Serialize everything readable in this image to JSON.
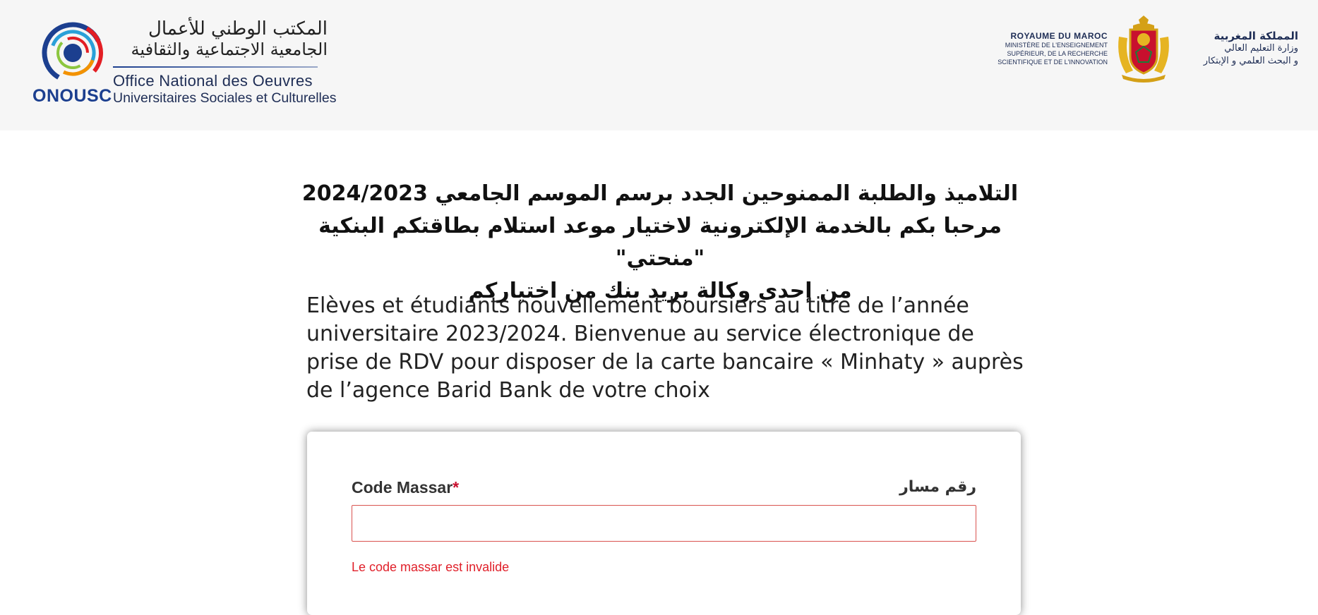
{
  "header": {
    "onousc": {
      "abbr": "ONOUSC",
      "arabic_line1": "المكتب الوطني للأعمال",
      "arabic_line2": "الجامعية الاجتماعية والثقافية",
      "french_line1": "Office National des Oeuvres",
      "french_line2": "Universitaires Sociales et Culturelles"
    },
    "ministry": {
      "fr_kingdom": "ROYAUME DU MAROC",
      "fr_line1": "MINISTÈRE DE L'ENSEIGNEMENT",
      "fr_line2": "SUPÉRIEUR, DE LA RECHERCHE",
      "fr_line3": "SCIENTIFIQUE ET DE L'INNOVATION",
      "ar_kingdom": "المملكة المغربية",
      "ar_line1": "وزارة التعليم العالي",
      "ar_line2": "و البحث العلمي و الإبتكار"
    }
  },
  "main": {
    "arabic_title_line1": "التلاميذ والطلبة الممنوحين الجدد برسم الموسم الجامعي 2024/2023",
    "arabic_title_line2": "مرحبا بكم بالخدمة الإلكترونية لاختيار موعد استلام بطاقتكم البنكية \"منحتي\"",
    "arabic_title_line3": "من إحدى وكالة بريد بنك من اختياركم",
    "french_intro": "Elèves et étudiants nouvellement boursiers au titre de l’année universitaire 2023/2024. Bienvenue au service électronique de prise de RDV pour disposer de la carte bancaire « Minhaty » auprès de l’agence Barid Bank de votre choix"
  },
  "form": {
    "code_massar_label": "Code Massar",
    "required_mark": "*",
    "code_massar_label_ar": "رقم مسار",
    "code_massar_value": "",
    "error_message": "Le code massar est invalide"
  },
  "colors": {
    "brand_blue": "#1c3f8f",
    "error_red": "#e0202a",
    "input_border": "#d9534f",
    "header_bg": "#f6f6f6"
  }
}
